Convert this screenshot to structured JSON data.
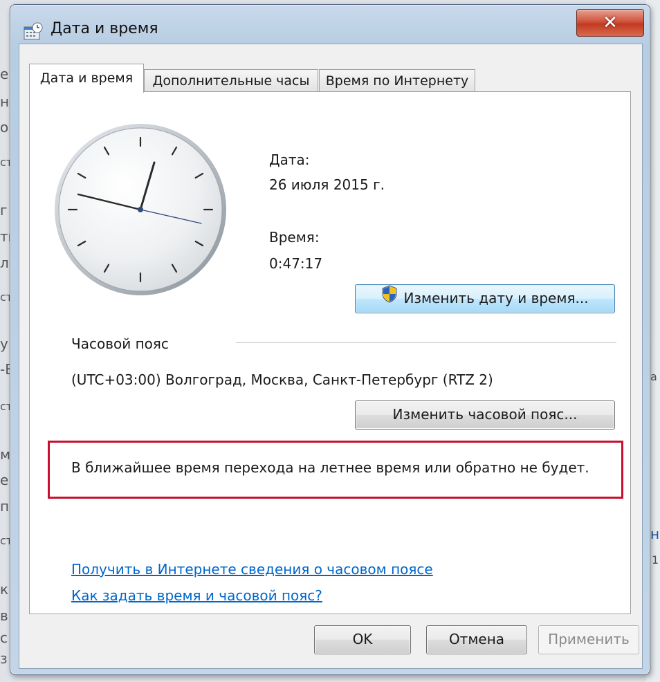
{
  "background_fragments": [
    "е",
    "на",
    "о",
    "ст",
    "г",
    "ть",
    "ла",
    "ст",
    "у",
    "-В",
    "ст",
    "м",
    "е",
    "п",
    "ст",
    "к",
    "в",
    "с",
    "з",
    "а",
    "ст",
    "н",
    "1"
  ],
  "window": {
    "title": "Дата и время",
    "close_label": "✕"
  },
  "tabs": [
    {
      "label": "Дата и время",
      "active": true
    },
    {
      "label": "Дополнительные часы",
      "active": false
    },
    {
      "label": "Время по Интернету",
      "active": false
    }
  ],
  "datetime": {
    "date_label": "Дата:",
    "date_value": "26 июля 2015 г.",
    "time_label": "Время:",
    "time_value": "0:47:17",
    "change_button": "Изменить дату и время..."
  },
  "timezone": {
    "section_label": "Часовой пояс",
    "value": "(UTC+03:00) Волгоград, Москва, Санкт-Петербург (RTZ 2)",
    "change_button": "Изменить часовой пояс...",
    "dst_message": "В ближайшее время перехода на летнее время или обратно не будет."
  },
  "links": {
    "info_online": "Получить в Интернете сведения о часовом поясе",
    "how_to": "Как задать время и часовой пояс?"
  },
  "footer": {
    "ok": "OK",
    "cancel": "Отмена",
    "apply": "Применить"
  },
  "colors": {
    "highlight_border": "#c8102e",
    "link": "#0066cc",
    "close_button": "#c23a22"
  },
  "icons": {
    "title": "clock-calendar-icon",
    "change_datetime": "uac-shield-icon"
  }
}
